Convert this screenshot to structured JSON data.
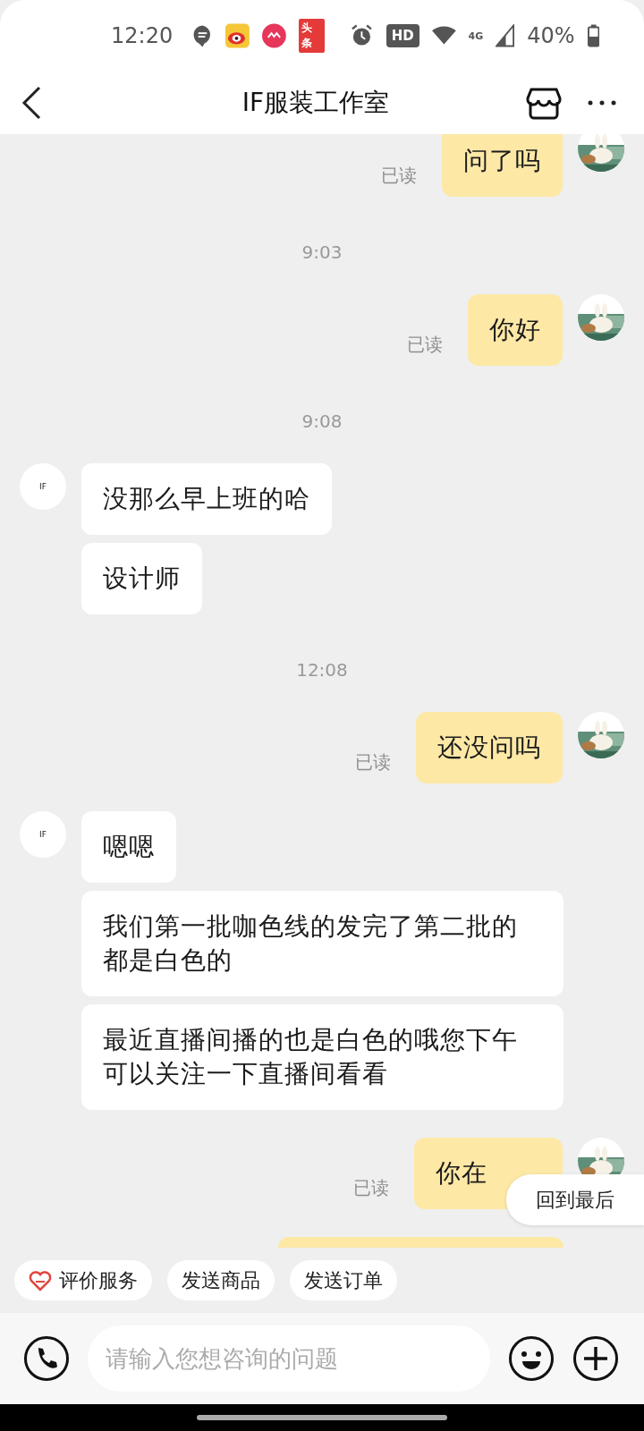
{
  "status_bar": {
    "time": "12:20",
    "badge_text": "头条",
    "battery": "40%",
    "network": "4G",
    "hd": "HD"
  },
  "header": {
    "title": "IF服装工作室"
  },
  "messages": [
    {
      "kind": "sent",
      "text": "问了吗",
      "read_label": "已读"
    },
    {
      "kind": "time",
      "text": "9:03"
    },
    {
      "kind": "sent",
      "text": "你好",
      "read_label": "已读"
    },
    {
      "kind": "time",
      "text": "9:08"
    },
    {
      "kind": "received",
      "text": "没那么早上班的哈",
      "avatar_text": "IF"
    },
    {
      "kind": "received",
      "text": "设计师"
    },
    {
      "kind": "time",
      "text": "12:08"
    },
    {
      "kind": "sent",
      "text": "还没问吗",
      "read_label": "已读"
    },
    {
      "kind": "received",
      "text": "嗯嗯",
      "avatar_text": "IF"
    },
    {
      "kind": "received",
      "text": "我们第一批咖色线的发完了第二批的都是白色的"
    },
    {
      "kind": "received",
      "text": "最近直播间播的也是白色的哦您下午可以关注一下直播间看看"
    },
    {
      "kind": "sent",
      "text": "你在",
      "read_label": "已读",
      "covered": true
    },
    {
      "kind": "partial_sent"
    }
  ],
  "jump_button": {
    "label": "回到最后"
  },
  "quick_actions": [
    {
      "label": "评价服务",
      "icon": true
    },
    {
      "label": "发送商品",
      "icon": false
    },
    {
      "label": "发送订单",
      "icon": false
    }
  ],
  "input": {
    "placeholder": "请输入您想咨询的问题"
  }
}
